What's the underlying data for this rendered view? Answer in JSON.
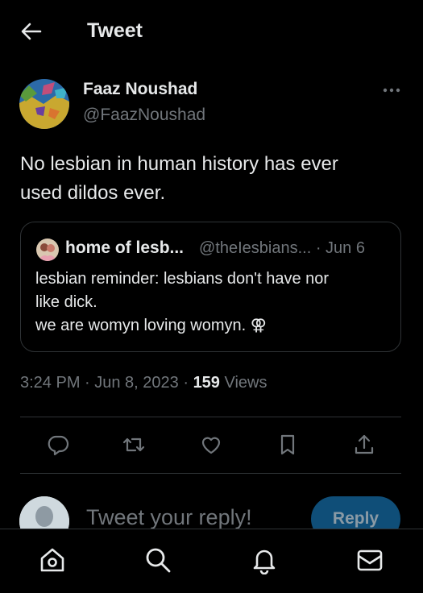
{
  "header": {
    "title": "Tweet"
  },
  "author": {
    "name": "Faaz Noushad",
    "handle": "@FaazNoushad"
  },
  "tweet": {
    "lines": [
      "No lesbian in human history has ever",
      "used dildos ever."
    ]
  },
  "quote": {
    "name": "home of lesb...",
    "meta": "@theIesbians... · Jun 6",
    "lines": [
      "lesbian reminder: lesbians don't have nor",
      "like dick.",
      "we are womyn loving womyn. ⚢"
    ]
  },
  "meta": {
    "time_date": "3:24 PM · Jun 8, 2023 · ",
    "views_count": "159",
    "views_label": " Views"
  },
  "actions": [
    {
      "icon": "reply-icon"
    },
    {
      "icon": "retweet-icon"
    },
    {
      "icon": "like-icon"
    },
    {
      "icon": "bookmark-icon"
    },
    {
      "icon": "share-icon"
    }
  ],
  "reply": {
    "placeholder": "Tweet your reply!",
    "button_label": "Reply"
  },
  "nav": [
    {
      "icon": "home-icon"
    },
    {
      "icon": "search-icon"
    },
    {
      "icon": "notifications-icon"
    },
    {
      "icon": "messages-icon"
    }
  ],
  "colors": {
    "background": "#000000",
    "text": "#e7e9ea",
    "muted": "#71767b",
    "border": "#2f3336",
    "reply_button": "#0f4e78"
  }
}
